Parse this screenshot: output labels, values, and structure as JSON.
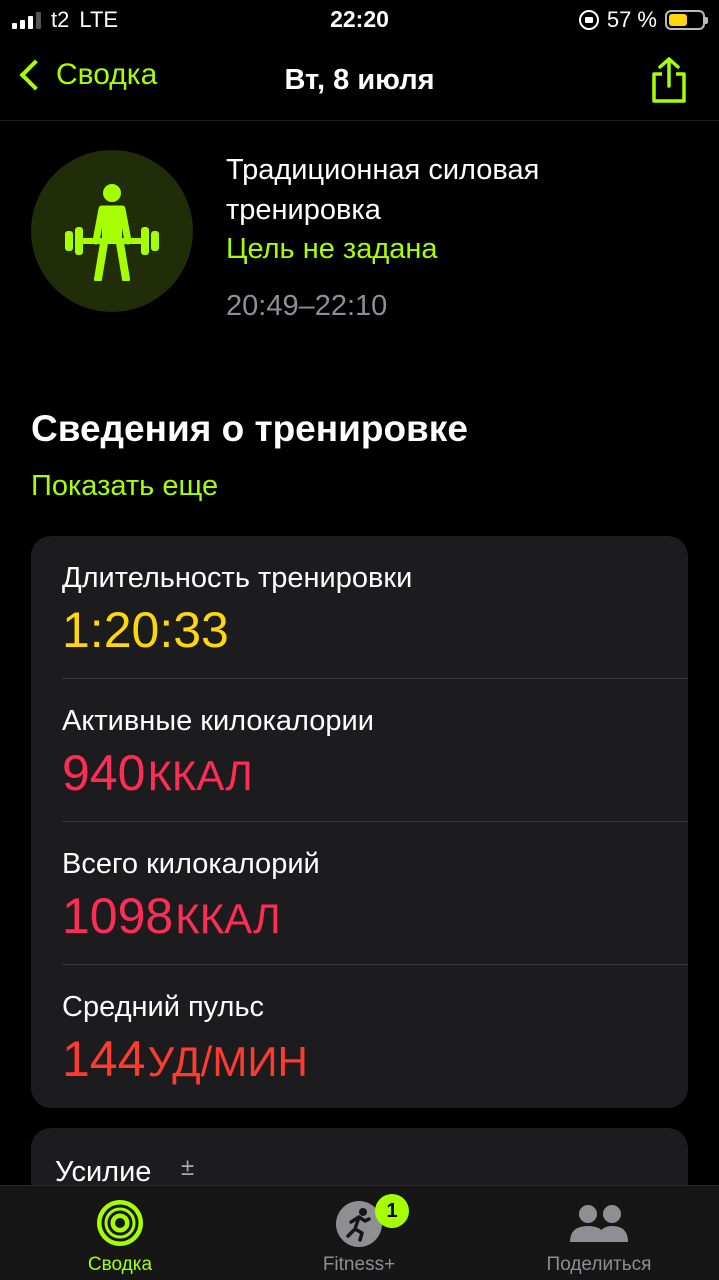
{
  "status_bar": {
    "carrier": "t2",
    "network": "LTE",
    "time": "22:20",
    "battery_percent": "57 %",
    "battery_level": 0.57
  },
  "nav": {
    "back_label": "Сводка",
    "title": "Вт, 8 июля"
  },
  "workout": {
    "name": "Традиционная силовая тренировка",
    "goal": "Цель не задана",
    "time_range": "20:49–22:10",
    "icon": "weightlifting-icon"
  },
  "details": {
    "title": "Сведения о тренировке",
    "show_more": "Показать еще",
    "metrics": [
      {
        "label": "Длительность тренировки",
        "value": "1:20:33",
        "unit": "",
        "color": "#ffd60a"
      },
      {
        "label": "Активные килокалории",
        "value": "940",
        "unit": "ккал",
        "color": "#ff2d55"
      },
      {
        "label": "Всего килокалорий",
        "value": "1098",
        "unit": "ккал",
        "color": "#ff2d55"
      },
      {
        "label": "Средний пульс",
        "value": "144",
        "unit": "уд/мин",
        "color": "#ff3b30"
      }
    ]
  },
  "effort": {
    "label": "Усилие",
    "symbol": "±"
  },
  "tabs": [
    {
      "label": "Сводка",
      "icon": "activity-rings-icon",
      "active": true
    },
    {
      "label": "Fitness+",
      "icon": "fitness-plus-icon",
      "badge": "1"
    },
    {
      "label": "Поделиться",
      "icon": "sharing-people-icon"
    }
  ],
  "colors": {
    "accent": "#a6ff00",
    "background": "#000000",
    "card": "#1c1c1e"
  }
}
